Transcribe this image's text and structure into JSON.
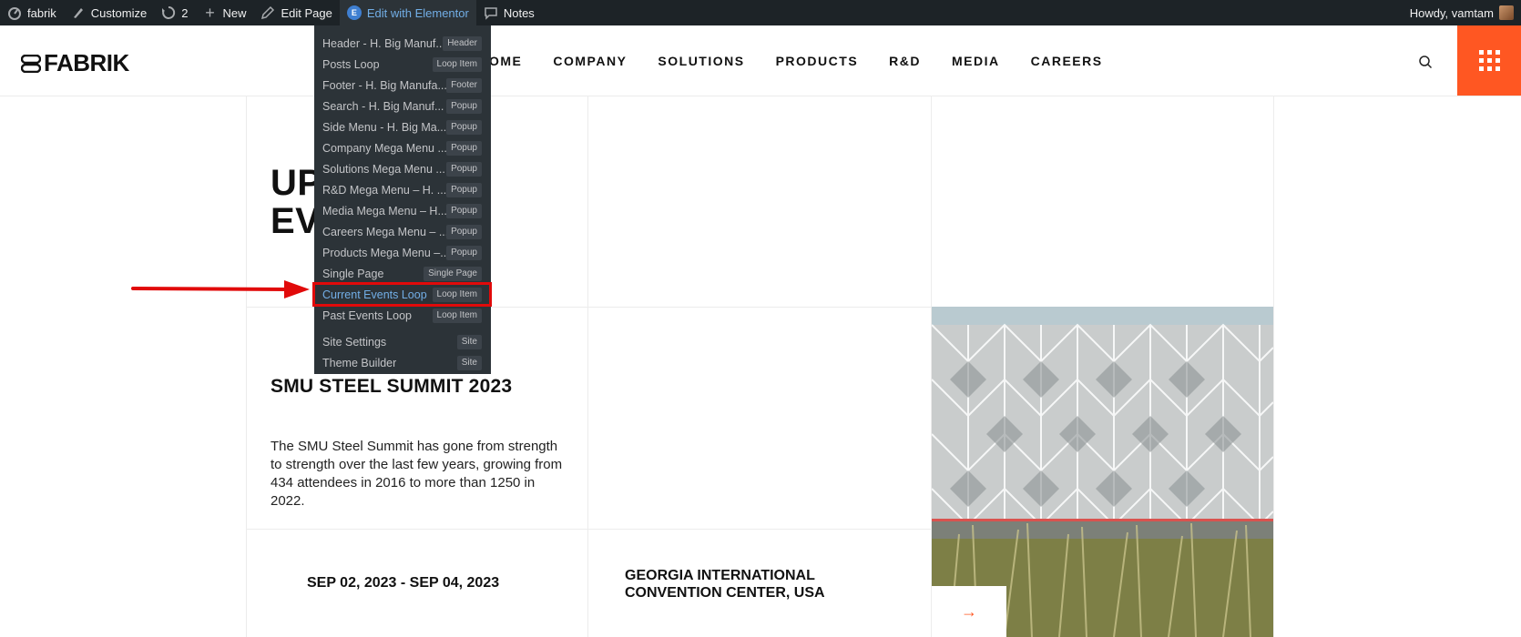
{
  "admin_bar": {
    "site": "fabrik",
    "customize": "Customize",
    "updates": "2",
    "new": "New",
    "edit_page": "Edit Page",
    "edit_with_elementor": "Edit with Elementor",
    "notes": "Notes",
    "greeting": "Howdy, vamtam"
  },
  "header": {
    "logo": "FABRIK",
    "nav": [
      "OME",
      "COMPANY",
      "SOLUTIONS",
      "PRODUCTS",
      "R&D",
      "MEDIA",
      "CAREERS"
    ]
  },
  "content": {
    "title_line1": "UP",
    "title_line2": "EV",
    "event_title": "SMU STEEL SUMMIT 2023",
    "event_description": "The SMU Steel Summit has gone from strength to strength over the last few years, growing from 434 attendees in 2016 to more than 1250 in 2022.",
    "event_date": "SEP 02, 2023 - SEP 04, 2023",
    "event_venue": "GEORGIA INTERNATIONAL CONVENTION CENTER, USA"
  },
  "dropdown": {
    "items": [
      {
        "label": "Header - H. Big Manuf...",
        "badge": "Header"
      },
      {
        "label": "Posts Loop",
        "badge": "Loop Item"
      },
      {
        "label": "Footer - H. Big Manufa...",
        "badge": "Footer"
      },
      {
        "label": "Search - H. Big Manuf...",
        "badge": "Popup"
      },
      {
        "label": "Side Menu - H. Big Ma...",
        "badge": "Popup"
      },
      {
        "label": "Company Mega Menu ...",
        "badge": "Popup"
      },
      {
        "label": "Solutions Mega Menu ...",
        "badge": "Popup"
      },
      {
        "label": "R&D Mega Menu – H. ...",
        "badge": "Popup"
      },
      {
        "label": "Media Mega Menu – H....",
        "badge": "Popup"
      },
      {
        "label": "Careers Mega Menu – ...",
        "badge": "Popup"
      },
      {
        "label": "Products Mega Menu –...",
        "badge": "Popup"
      },
      {
        "label": "Single Page",
        "badge": "Single Page"
      },
      {
        "label": "Current Events Loop",
        "badge": "Loop Item"
      },
      {
        "label": "Past Events Loop",
        "badge": "Loop Item"
      },
      {
        "label": "Site Settings",
        "badge": "Site"
      },
      {
        "label": "Theme Builder",
        "badge": "Site"
      }
    ]
  },
  "colors": {
    "accent_orange": "#ff5722",
    "admin_bar": "#1d2327",
    "highlight_red": "#e10a0a",
    "link_blue": "#72aee6"
  }
}
